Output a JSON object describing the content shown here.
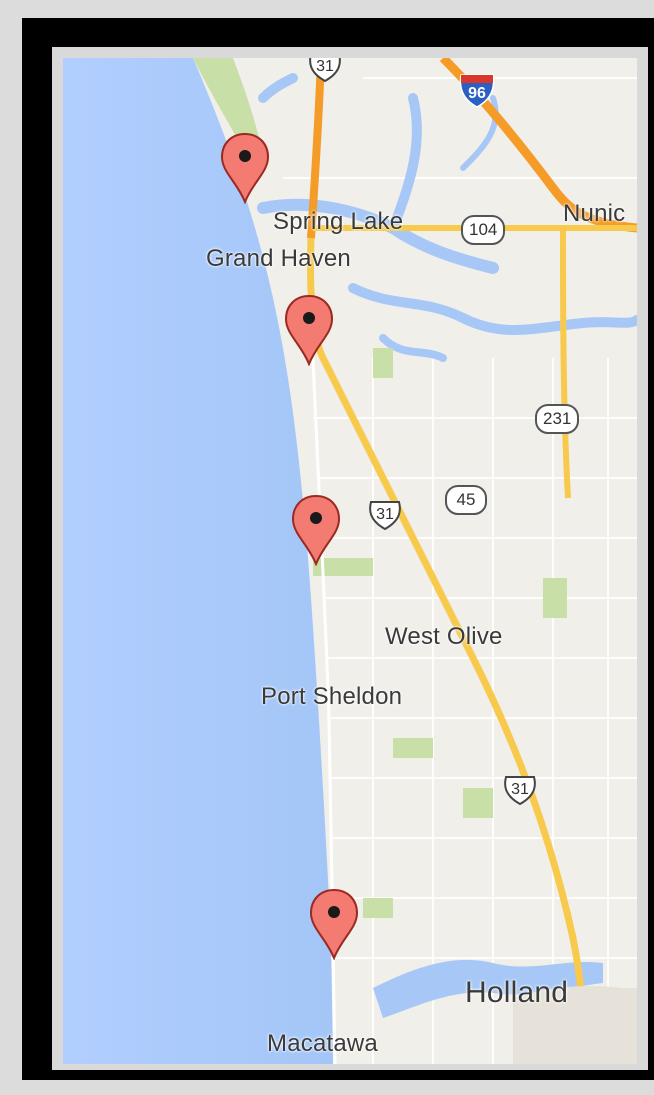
{
  "places": {
    "spring_lake": "Spring Lake",
    "grand_haven": "Grand Haven",
    "nunica": "Nunic",
    "west_olive": "West Olive",
    "port_sheldon": "Port Sheldon",
    "holland": "Holland",
    "macatawa": "Macatawa"
  },
  "routes": {
    "i96": "96",
    "us31_top": "31",
    "us31_mid": "31",
    "us31_low": "31",
    "m104": "104",
    "m231": "231",
    "m45": "45"
  },
  "colors": {
    "water": "#a7c8f7",
    "land": "#f1efe9",
    "park": "#c8dfa7",
    "highway": "#f7c94c",
    "freeway": "#f49c27",
    "pin": "#f47b72",
    "frame": "#000000"
  },
  "markers": [
    "map-pin-icon",
    "map-pin-icon",
    "map-pin-icon",
    "map-pin-icon"
  ]
}
